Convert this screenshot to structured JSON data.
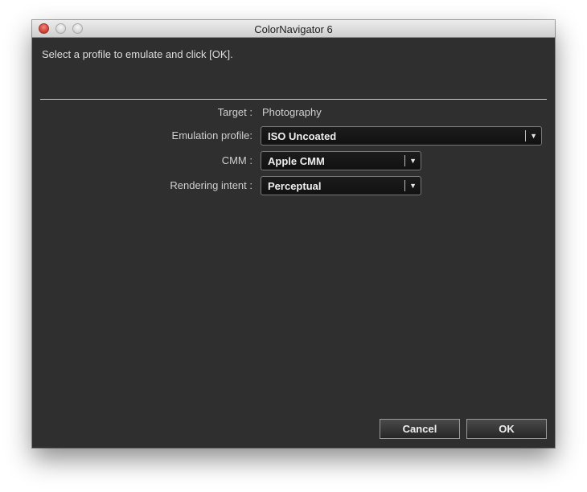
{
  "window": {
    "title": "ColorNavigator 6"
  },
  "instruction": "Select a profile to emulate and click [OK].",
  "form": {
    "target": {
      "label": "Target :",
      "value": "Photography"
    },
    "emulation_profile": {
      "label": "Emulation profile:",
      "value": "ISO Uncoated"
    },
    "cmm": {
      "label": "CMM :",
      "value": "Apple CMM"
    },
    "rendering_intent": {
      "label": "Rendering intent :",
      "value": "Perceptual"
    }
  },
  "buttons": {
    "cancel": "Cancel",
    "ok": "OK"
  },
  "icons": {
    "close": "close-icon",
    "minimize": "minimize-icon",
    "zoom": "zoom-icon",
    "dropdown_arrow": "chevron-down-icon"
  },
  "colors": {
    "window_bg": "#2f2f2f",
    "close_button": "#d9493d",
    "text": "#dedede"
  }
}
